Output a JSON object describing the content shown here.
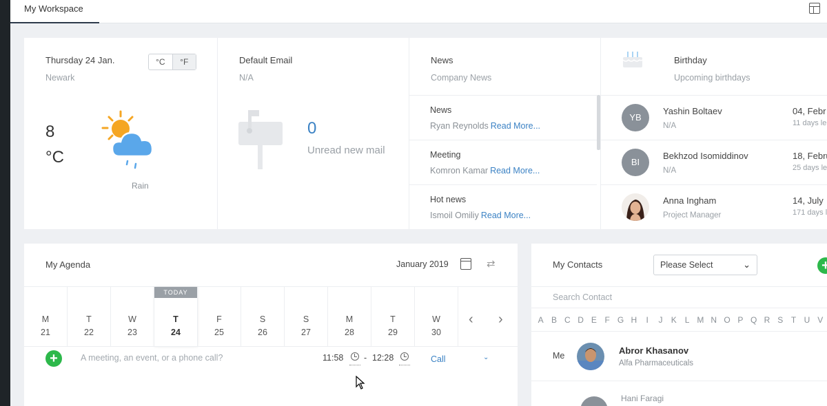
{
  "topbar": {
    "tab_label": "My Workspace",
    "layout_icon": "layout-icon"
  },
  "weather": {
    "date": "Thursday 24 Jan.",
    "location": "Newark",
    "unit_c": "°C",
    "unit_f": "°F",
    "selected_unit": "°F",
    "temperature": "8",
    "temperature_unit": "°C",
    "condition": "Rain",
    "icon": "sun-cloud-rain-icon"
  },
  "email": {
    "title": "Default Email",
    "address": "N/A",
    "unread_count": "0",
    "unread_label": "Unread new mail",
    "icon": "mailbox-icon"
  },
  "news": {
    "title": "News",
    "subtitle": "Company News",
    "items": [
      {
        "title": "News",
        "author": "Ryan Reynolds",
        "link": "Read More..."
      },
      {
        "title": "Meeting",
        "author": "Komron Kamar",
        "link": "Read More..."
      },
      {
        "title": "Hot news",
        "author": "Ismoil Omiliy",
        "link": "Read More..."
      }
    ]
  },
  "birthday": {
    "title": "Birthday",
    "subtitle": "Upcoming birthdays",
    "icon": "cake-icon",
    "items": [
      {
        "initials": "YB",
        "name": "Yashin Boltaev",
        "role": "N/A",
        "date": "04, Febr",
        "days_left": "11 days le"
      },
      {
        "initials": "BI",
        "name": "Bekhzod Isomiddinov",
        "role": "N/A",
        "date": "18, Febru",
        "days_left": "25 days le"
      },
      {
        "initials": "",
        "name": "Anna Ingham",
        "role": "Project Manager",
        "date": "14, July",
        "days_left": "171 days le"
      }
    ]
  },
  "agenda": {
    "title": "My Agenda",
    "month": "January 2019",
    "today_badge": "TODAY",
    "days": [
      {
        "dow": "M",
        "num": "21"
      },
      {
        "dow": "T",
        "num": "22"
      },
      {
        "dow": "W",
        "num": "23"
      },
      {
        "dow": "T",
        "num": "24"
      },
      {
        "dow": "F",
        "num": "25"
      },
      {
        "dow": "S",
        "num": "26"
      },
      {
        "dow": "S",
        "num": "27"
      },
      {
        "dow": "M",
        "num": "28"
      },
      {
        "dow": "T",
        "num": "29"
      },
      {
        "dow": "W",
        "num": "30"
      }
    ],
    "today_index": 3,
    "event_placeholder": "A meeting, an event, or a phone call?",
    "start_time": "11:58",
    "separator": "-",
    "end_time": "12:28",
    "event_type": "Call"
  },
  "contacts": {
    "title": "My Contacts",
    "select_value": "Please Select",
    "search_placeholder": "Search Contact",
    "alphabet": [
      "A",
      "B",
      "C",
      "D",
      "E",
      "F",
      "G",
      "H",
      "I",
      "J",
      "K",
      "L",
      "M",
      "N",
      "O",
      "P",
      "Q",
      "R",
      "S",
      "T",
      "U",
      "V"
    ],
    "me_label": "Me",
    "me_name": "Abror Khasanov",
    "me_company": "Alfa Pharmaceuticals",
    "next_name": "Hani Faragi"
  },
  "colors": {
    "accent": "#3b82c4",
    "add_green": "#2db84b",
    "avatar_gray": "#8a9199"
  }
}
